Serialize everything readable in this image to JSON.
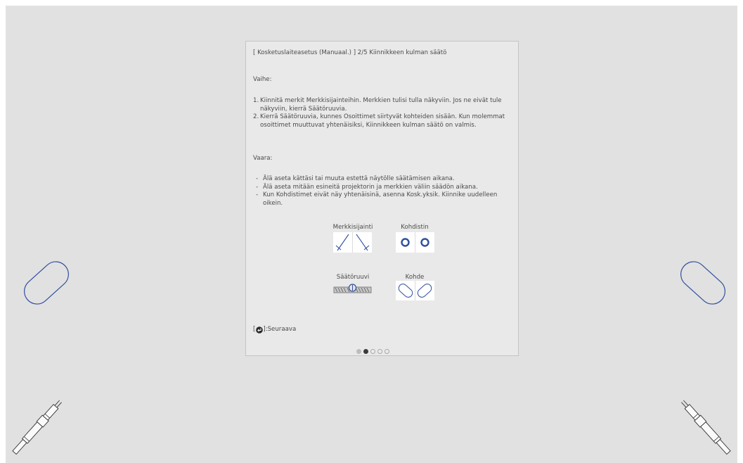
{
  "panel": {
    "title": "[ Kosketuslaiteasetus (Manuaal.) ]  2/5 Kiinnikkeen kulman säätö",
    "steps_heading": "Vaihe:",
    "steps": [
      {
        "num": "1.",
        "text": "Kiinnitä merkit Merkkisijainteihin. Merkkien tulisi tulla näkyviin. Jos ne eivät tule näkyviin, kierrä Säätöruuvia."
      },
      {
        "num": "2.",
        "text": "Kierrä Säätöruuvia, kunnes Osoittimet siirtyvät kohteiden sisään. Kun molemmat osoittimet muuttuvat yhtenäisiksi, Kiinnikkeen kulman säätö on valmis."
      }
    ],
    "warning_heading": "Vaara:",
    "warnings": [
      "Älä aseta kättäsi tai muuta estettä näytölle säätämisen aikana.",
      "Älä aseta mitään esineitä projektorin ja merkkien väliin säädön aikana.",
      "Kun Kohdistimet eivät näy yhtenäisinä, asenna Kosk.yksik. Kiinnike uudelleen oikein."
    ],
    "legend": {
      "marker_position": "Merkkisijainti",
      "pointer": "Kohdistin",
      "adjustment_screw": "Säätöruuvi",
      "target": "Kohde"
    },
    "next_label": "]:Seuraava",
    "next_open_bracket": "[",
    "page_indicator": {
      "current": 2,
      "total": 5
    }
  },
  "colors": {
    "background": "#e1e1e1",
    "panel": "#e9e9e9",
    "accent_blue": "#2f4f9e",
    "text": "#4a4a4a"
  },
  "icons": {
    "enter": "enter-icon",
    "marker": "marker-icon",
    "pointer": "pointer-icon",
    "target": "target-icon",
    "screw": "screw-icon",
    "pen": "touch-pen-icon"
  }
}
